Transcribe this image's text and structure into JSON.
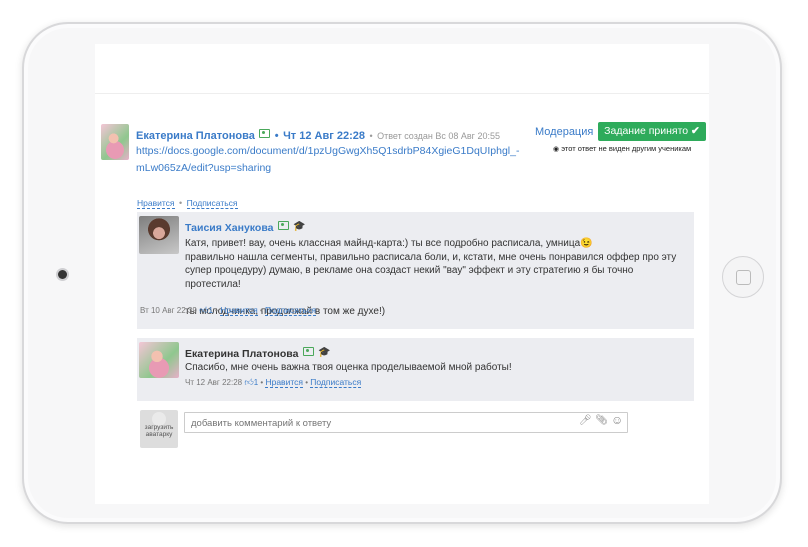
{
  "answer": {
    "author": "Екатерина Платонова",
    "date": "Чт 12 Авг 22:28",
    "created_note": "Ответ создан Вс 08 Авг 20:55",
    "link_line1": "https://docs.google.com/document/d/1pzUgGwgXh5Q1sdrbP84XgieG1DqUIphgl_-",
    "link_line2": "mLw065zA/edit?usp=sharing",
    "like_label": "Нравится",
    "subscribe_label": "Подписаться",
    "dot": "•"
  },
  "moderation_label": "Модерация",
  "accept_button": "Задание принято",
  "accept_icon": "check-icon",
  "hidden_note": "этот ответ не виден другим ученикам",
  "comments": [
    {
      "author": "Таисия Ханукова",
      "lines": [
        "Катя, привет! вау, очень классная майнд-карта:) ты все подробно расписала, умница😉",
        "правильно нашла сегменты, правильно расписала боли, и, кстати, мне очень понравился оффер про эту",
        "супер процедуру) думаю, в рекламе она создаст некий \"вау\" эффект и эту стратегию я бы точно протестила!",
        "",
        "ты молодчинка, продолжай в том же духе!)"
      ],
      "date": "Вт 10 Авг 22:39",
      "likes": "1",
      "like_label": "Нравится",
      "subscribe_label": "Подписаться"
    },
    {
      "author": "Екатерина Платонова",
      "lines": [
        "Спасибо, мне очень важна твоя оценка проделываемой мной работы!"
      ],
      "date": "Чт 12 Авг 22:28",
      "likes": "1",
      "like_label": "Нравится",
      "subscribe_label": "Подписаться"
    }
  ],
  "upload_avatar": [
    "загрузить",
    "аватарку"
  ],
  "comment_input": {
    "placeholder": "добавить комментарий к ответу"
  }
}
